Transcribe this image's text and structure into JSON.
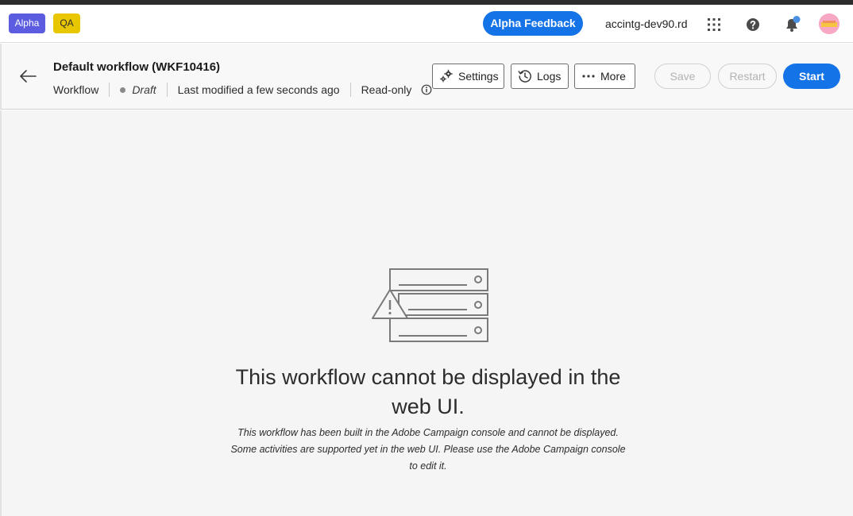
{
  "shell": {
    "badge_alpha": "Alpha",
    "badge_qa": "QA",
    "feedback_label": "Alpha Feedback",
    "org_name": "accintg-dev90.rd",
    "icons": [
      "apps-icon",
      "help-icon",
      "bell-icon",
      "avatar"
    ],
    "accent_color": "#1473e6"
  },
  "header": {
    "title": "Default workflow (WKF10416)",
    "type": "Workflow",
    "status": "Draft",
    "modified": "Last modified a few seconds ago",
    "access": "Read-only",
    "settings_label": "Settings",
    "logs_label": "Logs",
    "more_label": "More",
    "save_label": "Save",
    "restart_label": "Restart",
    "start_label": "Start"
  },
  "empty_state": {
    "title": "This workflow cannot be displayed in the web UI.",
    "description": "This workflow has been built in the Adobe Campaign console and cannot be displayed. Some activities are supported yet in the web UI. Please use the Adobe Campaign console to edit it."
  }
}
